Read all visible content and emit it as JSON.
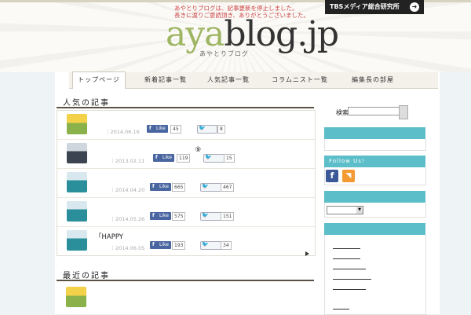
{
  "header": {
    "notice_line1": "あやとりブログは、記事更新を停止しました。",
    "notice_line2": "長きに渡りご愛読頂き、ありがとうございました。",
    "tbs_label": "TBSメディア総合研究所",
    "logo_aya": "aya",
    "logo_rest": "blog.jp",
    "logo_sub": "あやとりブログ"
  },
  "nav": {
    "items": [
      {
        "label": "トップページ"
      },
      {
        "label": "新着記事一覧"
      },
      {
        "label": "人気記事一覧"
      },
      {
        "label": "コラムニスト一覧"
      },
      {
        "label": "編集長の部屋"
      }
    ]
  },
  "popular": {
    "title": "人気の記事",
    "items": [
      {
        "title": "　　　　　　　　　　　　　　　",
        "author": "　　",
        "date": "2014.06.16",
        "fb_label": "Like",
        "fb_count": "45",
        "tw_label": "　　",
        "tw_count": "8"
      },
      {
        "title": "　　　　　　　　　　　　　　　⑨",
        "author": "　　　",
        "date": "2013.02.11",
        "fb_label": "Like",
        "fb_count": "119",
        "tw_label": "　　　",
        "tw_count": "15"
      },
      {
        "title": "　　　　　　　　　　　　　　　　　　　　　　　　　　",
        "author": "　　　",
        "date": "2014.04.20",
        "fb_label": "Like",
        "fb_count": "665",
        "tw_label": "　　　",
        "tw_count": "467"
      },
      {
        "title": "　　　　　　　　　　　　　",
        "author": "　　　",
        "date": "2014.05.26",
        "fb_label": "Like",
        "fb_count": "575",
        "tw_label": "　　　",
        "tw_count": "151"
      },
      {
        "title": "「HAPPY　　　　　　　　　　　　　　　　",
        "author": "　　　",
        "date": "2014.06.05",
        "fb_label": "Like",
        "fb_count": "193",
        "tw_label": "　　　",
        "tw_count": "34"
      }
    ],
    "more_label": "　　　　　"
  },
  "recent": {
    "title": "最近の記事",
    "item_title": "　　　　　　　　　　　　　　　",
    "item_excerpt": "　　　　　　　　　　　　　　　　　　　　　　　　　　　　　　　　　　　　　　　　　"
  },
  "sidebar": {
    "search_label": "検索:",
    "search_value": "",
    "widget1_title": "　　　　　",
    "follow_title": "Follow Us!",
    "facebook_glyph": "f",
    "rss_glyph": "◥",
    "widget3_title": "　　　　",
    "archive_selected": "　　　",
    "widget4_title": "　　　　　　　",
    "links": [
      "　　　　　",
      "　　　　　",
      "　　　　　　",
      "　　　　　　　",
      "　　　　　　",
      "　　　"
    ]
  },
  "colors": {
    "accent": "#5cbec9",
    "logo_green": "#9eb562",
    "facebook": "#4a66a0",
    "rss": "#f39a33"
  }
}
